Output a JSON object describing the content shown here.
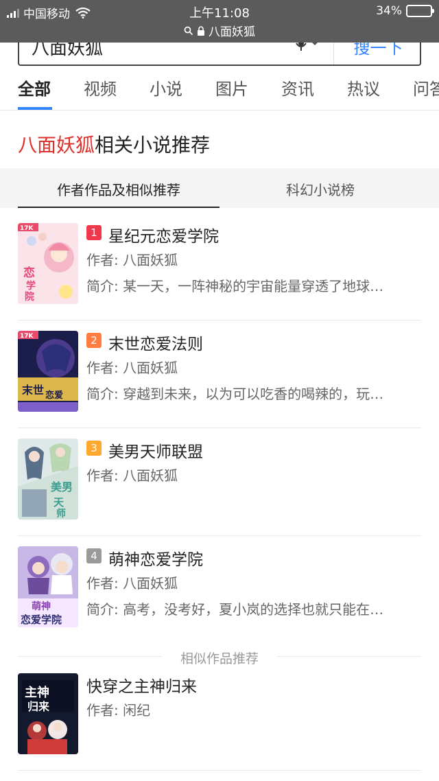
{
  "status_bar": {
    "carrier": "中国移动",
    "time": "上午11:08",
    "url": "八面妖狐",
    "battery": "34%",
    "battery_level": 0.34
  },
  "search": {
    "query": "八面妖狐",
    "button": "搜一下"
  },
  "categories": [
    "全部",
    "视频",
    "小说",
    "图片",
    "资讯",
    "热议",
    "问答"
  ],
  "heading": {
    "keyword": "八面妖狐",
    "suffix": "相关小说推荐"
  },
  "sub_tabs": [
    "作者作品及相似推荐",
    "科幻小说榜"
  ],
  "books": [
    {
      "rank": "1",
      "title": "星纪元恋爱学院",
      "author": "作者: 八面妖狐",
      "intro": "简介: 某一天，一阵神秘的宇宙能量穿透了地球…",
      "cover_text": "恋爱学院"
    },
    {
      "rank": "2",
      "title": "末世恋爱法则",
      "author": "作者: 八面妖狐",
      "intro": "简介: 穿越到未来，以为可以吃香的喝辣的，玩…",
      "cover_text": "末世恋爱法则"
    },
    {
      "rank": "3",
      "title": "美男天师联盟",
      "author": "作者: 八面妖狐",
      "intro": "",
      "cover_text": "美男天师"
    },
    {
      "rank": "4",
      "title": "萌神恋爱学院",
      "author": "作者: 八面妖狐",
      "intro": "简介: 高考，没考好，夏小岚的选择也就只能在…",
      "cover_text": "萌神恋爱学院"
    }
  ],
  "similar_label": "相似作品推荐",
  "similar_books": [
    {
      "title": "快穿之主神归来",
      "author": "作者: 闲纪",
      "cover_text": "主神归来"
    }
  ],
  "colors": {
    "accent": "#3385ff",
    "keyword": "#e0302c",
    "rank1": "#f0384d",
    "rank2": "#ff7d41",
    "rank3": "#ffa82e",
    "rank4": "#9a9a9a"
  }
}
